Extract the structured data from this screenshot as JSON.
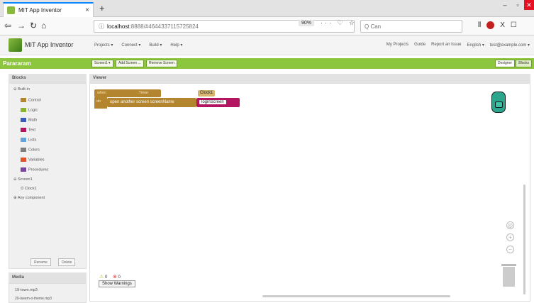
{
  "browser": {
    "tab_title": "MIT App Inventor",
    "tab_close": "×",
    "new_tab": "+",
    "url_info": "ⓘ",
    "url_host": "localhost",
    "url_path": ":8888/#4644337115725824",
    "zoom": "90%",
    "url_actions": "··· ♡ ☆",
    "search_placeholder": "Q  Can",
    "window_controls": [
      "–",
      "▫",
      "✕"
    ],
    "toolbar_icons": [
      "⫴",
      "X",
      "☐"
    ]
  },
  "app": {
    "name": "MIT App Inventor",
    "menu": [
      "Projects ▾",
      "Connect ▾",
      "Build ▾",
      "Help ▾"
    ],
    "right_menu": [
      "My Projects",
      "Guide",
      "Report an Issue",
      "English ▾",
      "test@example.com ▾"
    ]
  },
  "project": {
    "name": "Parararam",
    "screen_btn": "Screen1 ▾",
    "add_screen": "Add Screen ...",
    "remove_screen": "Remove Screen",
    "designer": "Designer",
    "blocks": "Blocks"
  },
  "blocks_panel": {
    "title": "Blocks",
    "builtin": "⊖ Built-in",
    "categories": [
      {
        "label": "Control",
        "color": "#b3852f"
      },
      {
        "label": "Logic",
        "color": "#8bb42e"
      },
      {
        "label": "Math",
        "color": "#3b5bbd"
      },
      {
        "label": "Text",
        "color": "#b31561"
      },
      {
        "label": "Lists",
        "color": "#62a4d9"
      },
      {
        "label": "Colors",
        "color": "#7e7e7e"
      },
      {
        "label": "Variables",
        "color": "#e0542b"
      },
      {
        "label": "Procedures",
        "color": "#7a43a1"
      }
    ],
    "screen": "⊖ Screen1",
    "clock": "Clock1",
    "any_component": "⊕ Any component",
    "rename": "Rename",
    "delete": "Delete"
  },
  "media_panel": {
    "title": "Media",
    "items": [
      "19-town.mp3",
      "20-Iseem-o-theme.mp3"
    ]
  },
  "viewer": {
    "title": "Viewer",
    "when": "when",
    "clock": "Clock1 ▾",
    "timer": ".Timer",
    "do": "do",
    "open_screen": "open another screen  screenName",
    "screen_value": "loginScreen",
    "warnings_count": "0",
    "errors_count": "0",
    "show_warnings": "Show Warnings"
  }
}
